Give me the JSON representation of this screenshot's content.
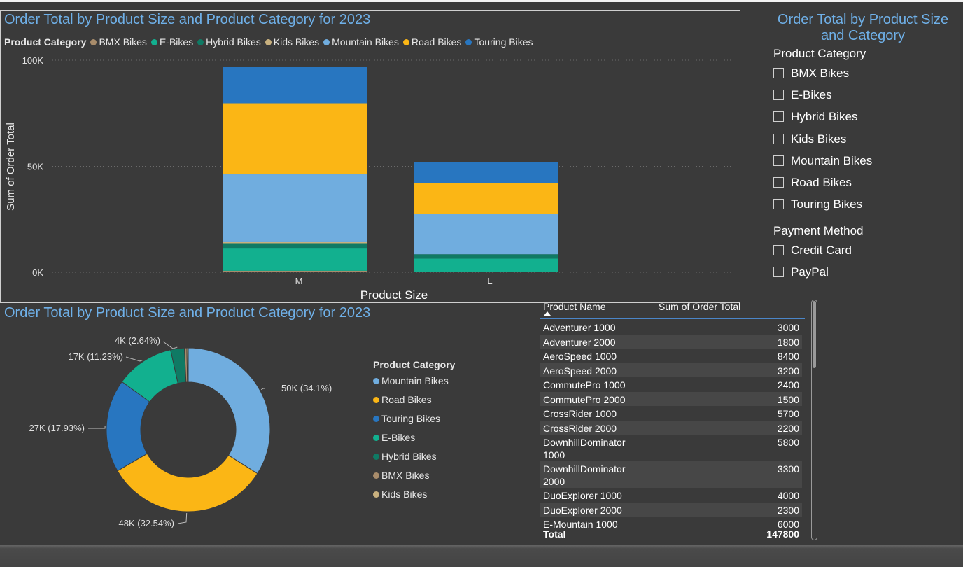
{
  "colors": {
    "bmx": "#a88c6b",
    "ebikes": "#12b08f",
    "hybrid": "#0f7a64",
    "kids": "#c8b07e",
    "mountain": "#70addf",
    "road": "#fbb615",
    "touring": "#2876c0",
    "title": "#6fb0e8"
  },
  "bar_panel": {
    "title": "Order Total by Product Size and Product Category for 2023",
    "legend_label": "Product Category"
  },
  "donut_panel": {
    "title": "Order Total by Product Size and Product Category for 2023",
    "legend_title": "Product Category"
  },
  "slicer": {
    "title_line1": "Order Total by Product Size",
    "title_line2": "and Category",
    "category_header": "Product Category",
    "categories": [
      "BMX Bikes",
      "E-Bikes",
      "Hybrid Bikes",
      "Kids Bikes",
      "Mountain Bikes",
      "Road Bikes",
      "Touring Bikes"
    ],
    "payment_header": "Payment Method",
    "payments": [
      "Credit Card",
      "PayPal"
    ]
  },
  "table": {
    "col_name": "Product Name",
    "col_value": "Sum of Order Total",
    "rows": [
      {
        "name": "Adventurer 1000",
        "value": "3000"
      },
      {
        "name": "Adventurer 2000",
        "value": "1800"
      },
      {
        "name": "AeroSpeed 1000",
        "value": "8400"
      },
      {
        "name": "AeroSpeed 2000",
        "value": "3200"
      },
      {
        "name": "CommutePro 1000",
        "value": "2400"
      },
      {
        "name": "CommutePro 2000",
        "value": "1500"
      },
      {
        "name": "CrossRider 1000",
        "value": "5700"
      },
      {
        "name": "CrossRider 2000",
        "value": "2200"
      },
      {
        "name": "DownhillDominator 1000",
        "value": "5800"
      },
      {
        "name": "DownhillDominator 2000",
        "value": "3300"
      },
      {
        "name": "DuoExplorer 1000",
        "value": "4000"
      },
      {
        "name": "DuoExplorer 2000",
        "value": "2300"
      },
      {
        "name": "E-Mountain 1000",
        "value": "6000"
      }
    ],
    "total_label": "Total",
    "total_value": "147800"
  },
  "chart_data": [
    {
      "type": "bar",
      "stacked": true,
      "title": "Order Total by Product Size and Product Category for 2023",
      "xlabel": "Product Size",
      "ylabel": "Sum of Order Total",
      "categories": [
        "M",
        "L"
      ],
      "ylim": [
        0,
        100000
      ],
      "yticks": [
        0,
        50000,
        100000
      ],
      "ytick_labels": [
        "0K",
        "50K",
        "100K"
      ],
      "legend_position": "top",
      "series": [
        {
          "name": "BMX Bikes",
          "color": "#a88c6b",
          "values": [
            700,
            0
          ]
        },
        {
          "name": "E-Bikes",
          "color": "#12b08f",
          "values": [
            10500,
            6500
          ]
        },
        {
          "name": "Hybrid Bikes",
          "color": "#0f7a64",
          "values": [
            2500,
            2000
          ]
        },
        {
          "name": "Kids Bikes",
          "color": "#c8b07e",
          "values": [
            500,
            0
          ]
        },
        {
          "name": "Mountain Bikes",
          "color": "#70addf",
          "values": [
            32000,
            19000
          ]
        },
        {
          "name": "Road Bikes",
          "color": "#fbb615",
          "values": [
            33500,
            14500
          ]
        },
        {
          "name": "Touring Bikes",
          "color": "#2876c0",
          "values": [
            17000,
            10000
          ]
        }
      ]
    },
    {
      "type": "pie",
      "donut": true,
      "title": "Order Total by Product Size and Product Category for 2023",
      "legend_position": "right",
      "slices": [
        {
          "name": "Mountain Bikes",
          "value": 50000,
          "percent": 34.1,
          "label": "50K (34.1%)",
          "color": "#70addf"
        },
        {
          "name": "Road Bikes",
          "value": 48000,
          "percent": 32.54,
          "label": "48K (32.54%)",
          "color": "#fbb615"
        },
        {
          "name": "Touring Bikes",
          "value": 27000,
          "percent": 17.93,
          "label": "27K (17.93%)",
          "color": "#2876c0"
        },
        {
          "name": "E-Bikes",
          "value": 17000,
          "percent": 11.23,
          "label": "17K (11.23%)",
          "color": "#12b08f"
        },
        {
          "name": "Hybrid Bikes",
          "value": 4000,
          "percent": 2.64,
          "label": "4K (2.64%)",
          "color": "#0f7a64"
        },
        {
          "name": "BMX Bikes",
          "value": 700,
          "percent": 0.9,
          "label": "",
          "color": "#a88c6b"
        },
        {
          "name": "Kids Bikes",
          "value": 400,
          "percent": 0.3,
          "label": "",
          "color": "#c8b07e"
        }
      ]
    }
  ]
}
